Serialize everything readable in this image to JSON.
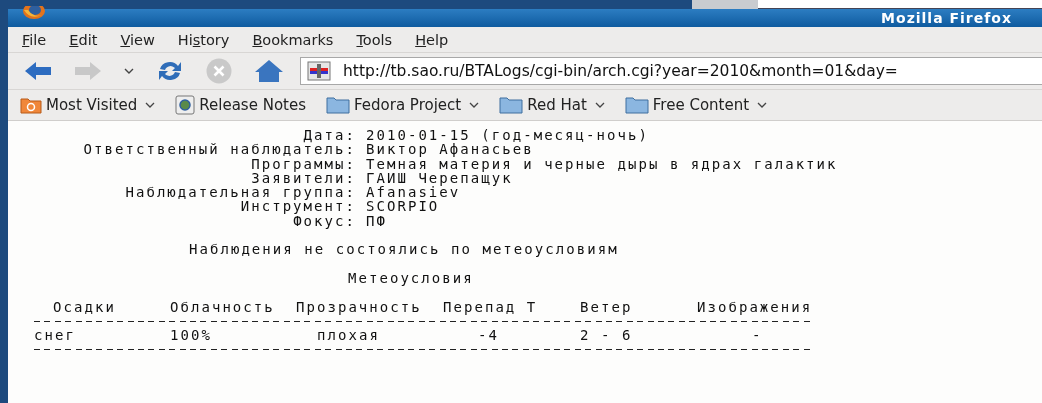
{
  "window": {
    "title": "Mozilla Firefox"
  },
  "menu": [
    {
      "key": "F",
      "after": "ile"
    },
    {
      "key": "E",
      "after": "dit"
    },
    {
      "key": "V",
      "after": "iew"
    },
    {
      "before": "Hi",
      "key": "s",
      "after": "tory"
    },
    {
      "key": "B",
      "after": "ookmarks"
    },
    {
      "key": "T",
      "after": "ools"
    },
    {
      "key": "H",
      "after": "elp"
    }
  ],
  "toolbar": {
    "back_disabled": false,
    "forward_disabled": true,
    "stop_disabled": true,
    "url": "http://tb.sao.ru/BTALogs/cgi-bin/arch.cgi?year=2010&month=01&day="
  },
  "bookmarks": [
    {
      "kind": "smart",
      "label": "Most Visited",
      "dropdown": true
    },
    {
      "kind": "page",
      "label": "Release Notes",
      "dropdown": false
    },
    {
      "kind": "folder",
      "label": "Fedora Project",
      "dropdown": true
    },
    {
      "kind": "folder",
      "label": "Red Hat",
      "dropdown": true
    },
    {
      "kind": "folder",
      "label": "Free Content",
      "dropdown": true
    }
  ],
  "page": {
    "fields": [
      {
        "label": "Дата:",
        "value": "2010-01-15 (год-месяц-ночь)"
      },
      {
        "label": "Ответственный наблюдатель:",
        "value": "Виктор Афанасьев"
      },
      {
        "label": "Программы:",
        "value": "Темная материя и черные дыры в ядрах галактик"
      },
      {
        "label": "Заявители:",
        "value": "ГАИШ Черепащук"
      },
      {
        "label": "Наблюдательная группа:",
        "value": "Afanasiev"
      },
      {
        "label": "Инструмент:",
        "value": "SCORPIO"
      },
      {
        "label": "Фокус:",
        "value": "ПФ"
      }
    ],
    "notice": "Наблюдения не состоялись по метеоусловиям",
    "weather_title": "Метеоусловия",
    "table": {
      "columns": [
        "Осадки",
        "Облачность",
        "Прозрачность",
        "Перепад Т",
        "Ветер",
        "Изображения"
      ],
      "rows": [
        [
          "снег",
          "100%",
          "плохая",
          "-4",
          "2 - 6",
          "-"
        ]
      ]
    }
  }
}
